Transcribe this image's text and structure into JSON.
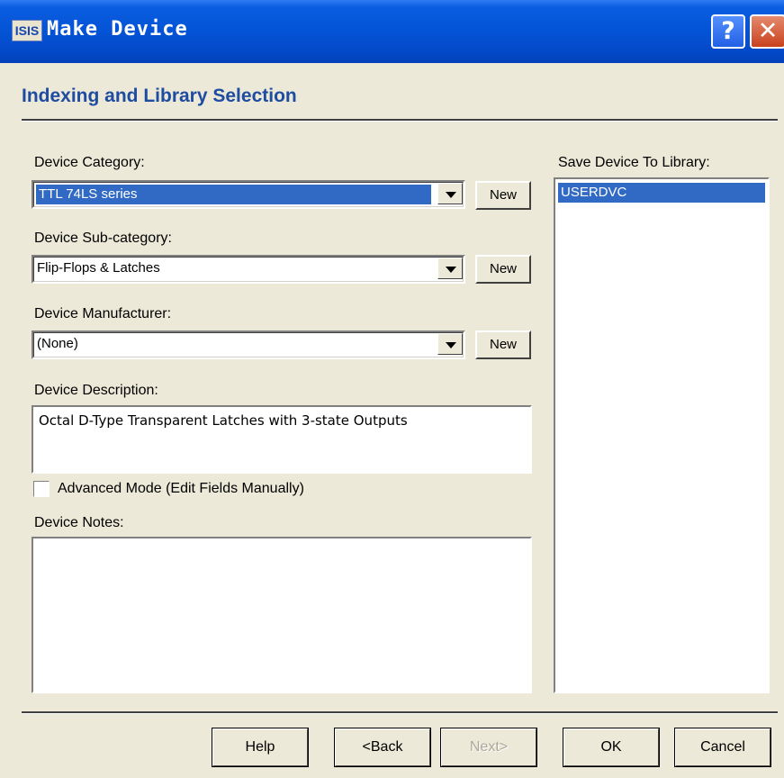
{
  "window": {
    "icon_text": "ISIS",
    "title": "Make Device",
    "help_glyph": "?",
    "close_glyph": "✕"
  },
  "heading": "Indexing and Library Selection",
  "category": {
    "label": "Device Category:",
    "value": "TTL 74LS series",
    "new_label": "New"
  },
  "subcategory": {
    "label": "Device Sub-category:",
    "value": "Flip-Flops & Latches",
    "new_label": "New"
  },
  "manufacturer": {
    "label": "Device Manufacturer:",
    "value": "(None)",
    "new_label": "New"
  },
  "description": {
    "label": "Device Description:",
    "value": "Octal D-Type Transparent Latches with 3-state Outputs"
  },
  "advanced_mode": {
    "label": "Advanced Mode (Edit Fields Manually)",
    "checked": false
  },
  "notes": {
    "label": "Device Notes:",
    "value": ""
  },
  "library": {
    "label": "Save Device To Library:",
    "items": [
      "USERDVC"
    ]
  },
  "buttons": {
    "help": "Help",
    "back": "<Back",
    "next": "Next>",
    "ok": "OK",
    "cancel": "Cancel"
  },
  "icons": {
    "dropdown": "chevron-down-icon",
    "app": "isis-app-icon",
    "help": "question-icon",
    "close": "close-icon"
  }
}
